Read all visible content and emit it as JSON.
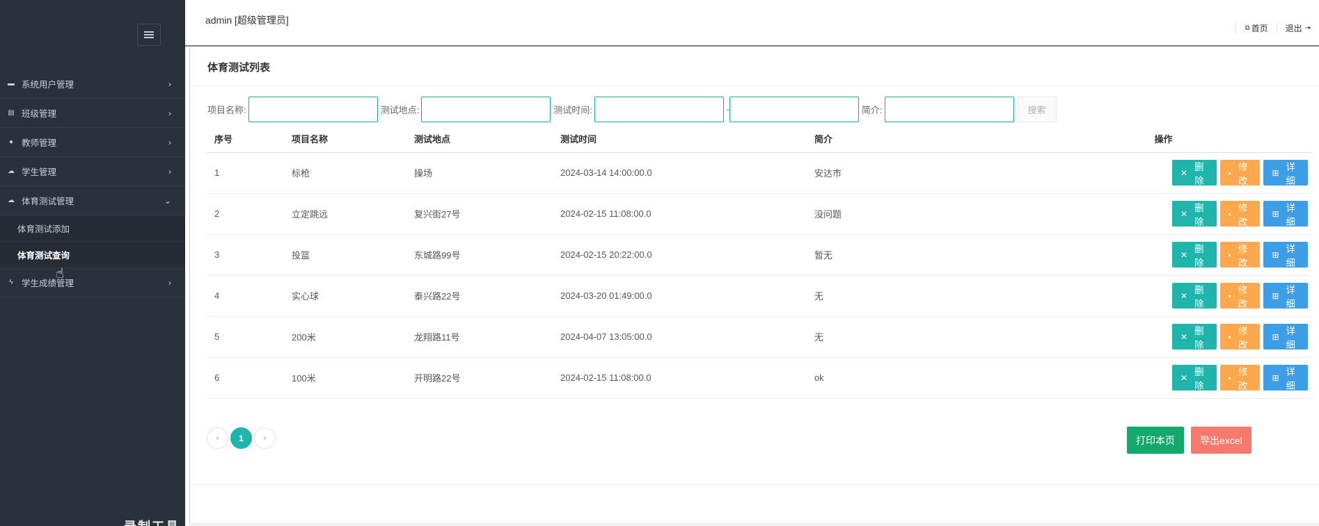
{
  "header": {
    "user": "admin [超级管理员]",
    "home_label": "首页",
    "logout_label": "退出"
  },
  "sidebar": {
    "items": [
      {
        "label": "系统用户管理",
        "icon": "user-icon"
      },
      {
        "label": "班级管理",
        "icon": "home-icon"
      },
      {
        "label": "教师管理",
        "icon": "globe-icon"
      },
      {
        "label": "学生管理",
        "icon": "cloud-icon"
      },
      {
        "label": "体育测试管理",
        "icon": "cloud-icon",
        "expanded": true,
        "children": [
          {
            "label": "体育测试添加"
          },
          {
            "label": "体育测试查询",
            "active": true
          }
        ]
      },
      {
        "label": "学生成绩管理",
        "icon": "bolt-icon"
      }
    ],
    "watermark": "录制工具"
  },
  "main": {
    "title": "体育测试列表",
    "search": {
      "name_label": "项目名称:",
      "place_label": "测试地点:",
      "time_label": "测试时间:",
      "time_sep": "-",
      "intro_label": "简介:",
      "search_button": "搜索"
    },
    "table": {
      "columns": [
        "序号",
        "项目名称",
        "测试地点",
        "测试时间",
        "简介",
        "操作"
      ],
      "rows": [
        [
          "1",
          "标枪",
          "操场",
          "2024-03-14 14:00:00.0",
          "安达市"
        ],
        [
          "2",
          "立定跳远",
          "复兴街27号",
          "2024-02-15 11:08:00.0",
          "没问题"
        ],
        [
          "3",
          "投篮",
          "东城路99号",
          "2024-02-15 20:22:00.0",
          "暂无"
        ],
        [
          "4",
          "实心球",
          "泰兴路22号",
          "2024-03-20 01:49:00.0",
          "无"
        ],
        [
          "5",
          "200米",
          "龙翔路11号",
          "2024-04-07 13:05:00.0",
          "无"
        ],
        [
          "6",
          "100米",
          "开明路22号",
          "2024-02-15 11:08:00.0",
          "ok"
        ]
      ],
      "actions": {
        "delete": "删除",
        "edit": "修改",
        "detail": "详细"
      }
    },
    "pager": {
      "prev": "‹",
      "current": "1",
      "next": "›"
    },
    "print_button": "打印本页",
    "excel_button": "导出excel"
  },
  "colors": {
    "sidebar_bg": "#2b313c",
    "accent_teal": "#1fb5ac",
    "edit_orange": "#fda84d",
    "detail_blue": "#3d9ee8",
    "print_green": "#13a86c",
    "excel_red": "#f5796c"
  }
}
